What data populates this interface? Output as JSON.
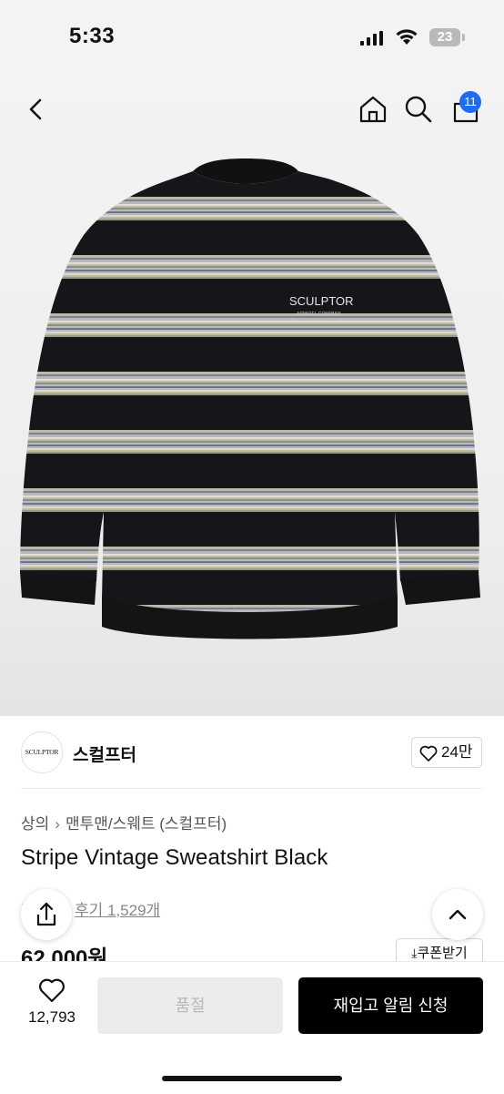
{
  "status_bar": {
    "time": "5:33",
    "battery": "23"
  },
  "header": {
    "cart_count": "11"
  },
  "product_image": {
    "print_main": "SCULPTOR",
    "print_sub": "APPAREL COMPANY"
  },
  "brand": {
    "logo_text": "SCULPTOR",
    "name": "스컬프터",
    "likes": "24만"
  },
  "breadcrumb": {
    "level1": "상의",
    "level2": "맨투맨/스웨트 (스컬프터)"
  },
  "product": {
    "title": "Stripe Vintage Sweatshirt Black",
    "reviews_label": "후기 1,529개",
    "price": "62,000원",
    "coupon_label": "쿠폰받기"
  },
  "bottom": {
    "wish_count": "12,793",
    "soldout_label": "품절",
    "restock_label": "재입고 알림 신청"
  },
  "colors": {
    "accent": "#1f6cf2",
    "primary_button": "#000000",
    "disabled_button": "#ececec",
    "star": "#f5a623"
  },
  "icons": [
    "back-icon",
    "home-icon",
    "search-icon",
    "cart-icon",
    "heart-icon",
    "share-icon",
    "chevron-up-icon",
    "download-icon"
  ]
}
